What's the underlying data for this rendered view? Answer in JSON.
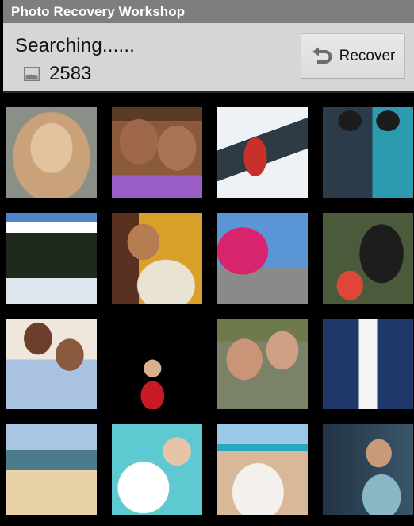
{
  "app": {
    "title": "Photo Recovery Workshop"
  },
  "header": {
    "status_text": "Searching......",
    "photo_count": "2583",
    "count_icon": "image-icon",
    "recover_button": {
      "label": "Recover",
      "icon": "undo-arrow-icon"
    }
  },
  "colors": {
    "titlebar_bg": "#7e7e7e",
    "header_bg": "#d6d6d6",
    "grid_bg": "#000000",
    "button_bg": "#e3e3e3"
  },
  "photos": [
    {
      "subject": "blonde woman portrait",
      "palette": [
        "#8a8f88",
        "#c9a27a",
        "#e3c2a0"
      ]
    },
    {
      "subject": "two smiling children",
      "palette": [
        "#5b3a26",
        "#8a5a3a",
        "#9b5ec7"
      ]
    },
    {
      "subject": "hiker on snowy mountain",
      "palette": [
        "#9fb6d3",
        "#eef2f6",
        "#c8302a"
      ]
    },
    {
      "subject": "two girls in beanies",
      "palette": [
        "#2b3b4a",
        "#46607a",
        "#2c9bb0"
      ]
    },
    {
      "subject": "snowy mountain forest",
      "palette": [
        "#4d86c7",
        "#ffffff",
        "#1f2a1c"
      ]
    },
    {
      "subject": "mother holding baby",
      "palette": [
        "#d9a02a",
        "#b77d52",
        "#e9e3d4"
      ]
    },
    {
      "subject": "pink tree by store",
      "palette": [
        "#5a95d6",
        "#d8246c",
        "#8a8a8a"
      ]
    },
    {
      "subject": "man with kids at laptop",
      "palette": [
        "#4a5a3a",
        "#1d1d1d",
        "#e0453a"
      ]
    },
    {
      "subject": "hugging couple",
      "palette": [
        "#efe7dc",
        "#6c3f2c",
        "#a9c2e0"
      ]
    },
    {
      "subject": "singers on stage",
      "palette": [
        "#000000",
        "#c81a26",
        "#d8b090"
      ]
    },
    {
      "subject": "girl and baby",
      "palette": [
        "#6f7a4c",
        "#c99478",
        "#7a8268"
      ]
    },
    {
      "subject": "sailor with women",
      "palette": [
        "#b9d1ea",
        "#1f3a6a",
        "#f5f5f5"
      ]
    },
    {
      "subject": "woman on beach",
      "palette": [
        "#a8c5e3",
        "#4a7c8c",
        "#e8d2a6"
      ]
    },
    {
      "subject": "woman lifting baby",
      "palette": [
        "#5fc9d2",
        "#ffffff",
        "#e6c4a8"
      ]
    },
    {
      "subject": "woman and baby on beach",
      "palette": [
        "#9ac8e6",
        "#f4f1ec",
        "#d9b89a"
      ]
    },
    {
      "subject": "toddler portrait",
      "palette": [
        "#213444",
        "#3a566a",
        "#8ab7c6"
      ]
    }
  ]
}
